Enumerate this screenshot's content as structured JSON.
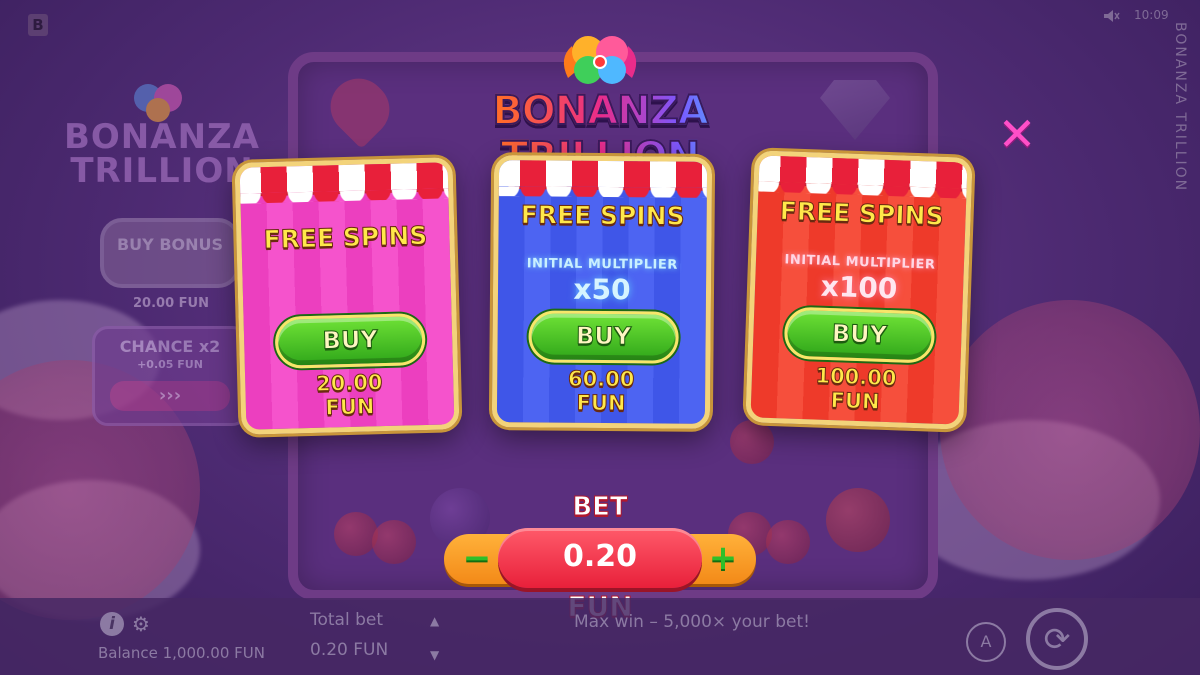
{
  "top": {
    "brand_letter": "B",
    "time": "10:09",
    "vertical_title": "BONANZA TRILLION"
  },
  "logo": {
    "title": "BONANZA TRILLION"
  },
  "side_panel": {
    "title": "BONANZA TRILLION",
    "buy_bonus_label": "BUY BONUS",
    "buy_bonus_price": "20.00 FUN",
    "chance_label": "CHANCE x2",
    "chance_sub": "+0.05 FUN",
    "chance_arrows": "›››"
  },
  "offers": [
    {
      "title": "FREE SPINS",
      "multiplier_label": "",
      "multiplier_value": "",
      "buy_label": "BUY",
      "price": "20.00",
      "currency": "FUN",
      "color": "#ec3fbf"
    },
    {
      "title": "FREE SPINS",
      "multiplier_label": "INITIAL MULTIPLIER",
      "multiplier_value": "x50",
      "buy_label": "BUY",
      "price": "60.00",
      "currency": "FUN",
      "color": "#3f56e8"
    },
    {
      "title": "FREE SPINS",
      "multiplier_label": "INITIAL MULTIPLIER",
      "multiplier_value": "x100",
      "buy_label": "BUY",
      "price": "100.00",
      "currency": "FUN",
      "color": "#ee3a2a"
    }
  ],
  "bet": {
    "label": "BET",
    "value": "0.20",
    "unit": "FUN",
    "minus": "−",
    "plus": "+"
  },
  "footer": {
    "info": "i",
    "balance": "Balance 1,000.00 FUN",
    "total_bet_label": "Total bet",
    "total_bet_value": "0.20 FUN",
    "max_win": "Max win – 5,000× your bet!",
    "auto_label": "A"
  },
  "colors": {
    "accent_yellow": "#ffe84a",
    "buy_green": "#2fa61a",
    "close_pink": "#ff4fc8"
  },
  "icons": {
    "close": "close-icon",
    "info": "info-icon",
    "settings": "gear-icon",
    "sound": "mute-icon",
    "spin": "spin-icon",
    "autoplay": "autoplay-icon"
  }
}
